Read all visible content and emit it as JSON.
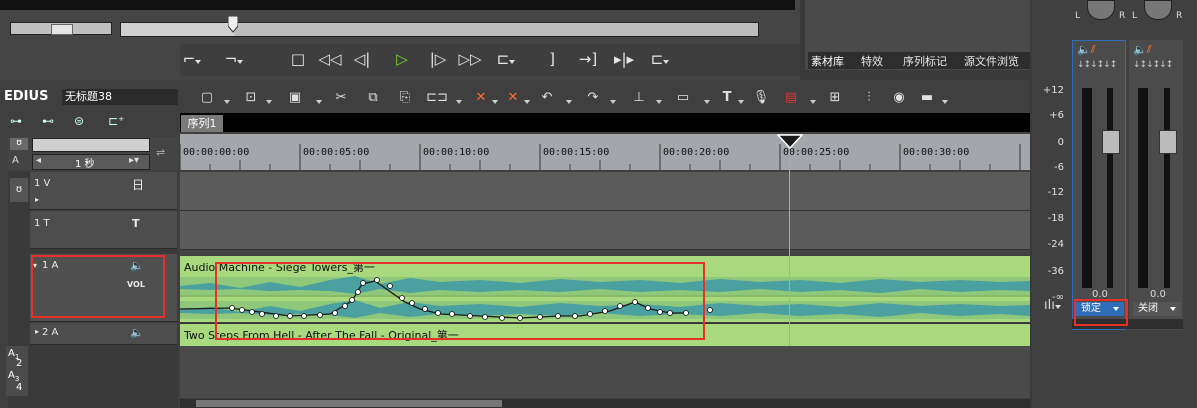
{
  "app": {
    "name": "EDIUS",
    "project": "无标题38"
  },
  "source_tabs": [
    {
      "label": "素材库"
    },
    {
      "label": "特效"
    },
    {
      "label": "序列标记"
    },
    {
      "label": "源文件浏览"
    }
  ],
  "timeline": {
    "sequence_tab": "序列1",
    "zoom_value": "1 秒",
    "ruler": [
      "00:00:00:00",
      "00:00:05:00",
      "00:00:10:00",
      "00:00:15:00",
      "00:00:20:00",
      "00:00:25:00",
      "00:00:30:00"
    ]
  },
  "tracks": {
    "v1": {
      "label": "1 V"
    },
    "t1": {
      "label": "1 T"
    },
    "a1": {
      "label": "1 A",
      "mode": "VOL"
    },
    "a2": {
      "label": "2 A"
    },
    "side_labels": [
      {
        "top": "A",
        "sub": "1"
      },
      {
        "top": "2",
        "sub": ""
      },
      {
        "top": "A",
        "sub": "3"
      },
      {
        "top": "4",
        "sub": ""
      }
    ]
  },
  "clips": {
    "audio1_name": "Audio Machine - Siege Towers_第一",
    "audio2_name": "Two Steps From Hell - After The Fall - Original_第一"
  },
  "mixer": {
    "scale": [
      "+12",
      "+6",
      "0",
      "-6",
      "-12",
      "-18",
      "-24",
      "-36",
      "-∞"
    ],
    "ch1_level": "0.0",
    "ch2_level": "0.0",
    "ch1_mode": "锁定",
    "ch2_mode": "关闭",
    "ch1_letters": [
      "L",
      "R"
    ],
    "ch2_letters": [
      "L",
      "R"
    ]
  },
  "colors": {
    "accent_green": "#79d237",
    "highlight_box": "#e8302a",
    "clip_audio": "#a9d97f",
    "waveform": "#4ba0a0",
    "meter_blue": "#2f6db8"
  }
}
